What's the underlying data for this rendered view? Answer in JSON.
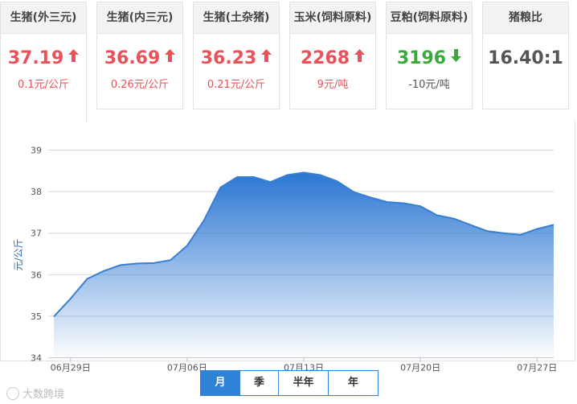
{
  "cards": [
    {
      "title": "生猪(外三元)",
      "value": "37.19",
      "change": "0.1元/公斤",
      "trend": "up"
    },
    {
      "title": "生猪(内三元)",
      "value": "36.69",
      "change": "0.26元/公斤",
      "trend": "up"
    },
    {
      "title": "生猪(土杂猪)",
      "value": "36.23",
      "change": "0.21元/公斤",
      "trend": "up"
    },
    {
      "title": "玉米(饲料原料)",
      "value": "2268",
      "change": "9元/吨",
      "trend": "up"
    },
    {
      "title": "豆粕(饲料原料)",
      "value": "3196",
      "change": "-10元/吨",
      "trend": "down"
    },
    {
      "title": "猪粮比",
      "value": "16.40:1",
      "change": "",
      "trend": "neutral"
    }
  ],
  "colors": {
    "up": "#e8525a",
    "down": "#3aa83a",
    "accent": "#2f83d6",
    "line": "#3a7fd0"
  },
  "periods": [
    "月",
    "季",
    "半年",
    "年"
  ],
  "selected_period": "月",
  "watermark": "大数跨境",
  "chart_data": {
    "type": "area",
    "title": "",
    "xlabel": "",
    "ylabel": "元/公斤",
    "ylim": [
      34,
      39
    ],
    "yticks": [
      34,
      35,
      36,
      37,
      38,
      39
    ],
    "x": [
      "06月28日",
      "06月29日",
      "06月30日",
      "07月01日",
      "07月02日",
      "07月03日",
      "07月04日",
      "07月05日",
      "07月06日",
      "07月07日",
      "07月08日",
      "07月09日",
      "07月10日",
      "07月11日",
      "07月12日",
      "07月13日",
      "07月14日",
      "07月15日",
      "07月16日",
      "07月17日",
      "07月18日",
      "07月19日",
      "07月20日",
      "07月21日",
      "07月22日",
      "07月23日",
      "07月24日",
      "07月25日",
      "07月26日",
      "07月27日",
      "07月28日"
    ],
    "xtick_labels": [
      "06月29日",
      "07月06日",
      "07月13日",
      "07月20日",
      "07月27日"
    ],
    "series": [
      {
        "values": [
          34.99,
          35.42,
          35.9,
          36.09,
          36.23,
          36.27,
          36.28,
          36.35,
          36.7,
          37.3,
          38.1,
          38.35,
          38.35,
          38.23,
          38.4,
          38.46,
          38.4,
          38.25,
          37.99,
          37.86,
          37.75,
          37.72,
          37.65,
          37.43,
          37.35,
          37.2,
          37.05,
          37.0,
          36.96,
          37.1,
          37.2
        ]
      }
    ],
    "grid": true,
    "legend": "none"
  }
}
